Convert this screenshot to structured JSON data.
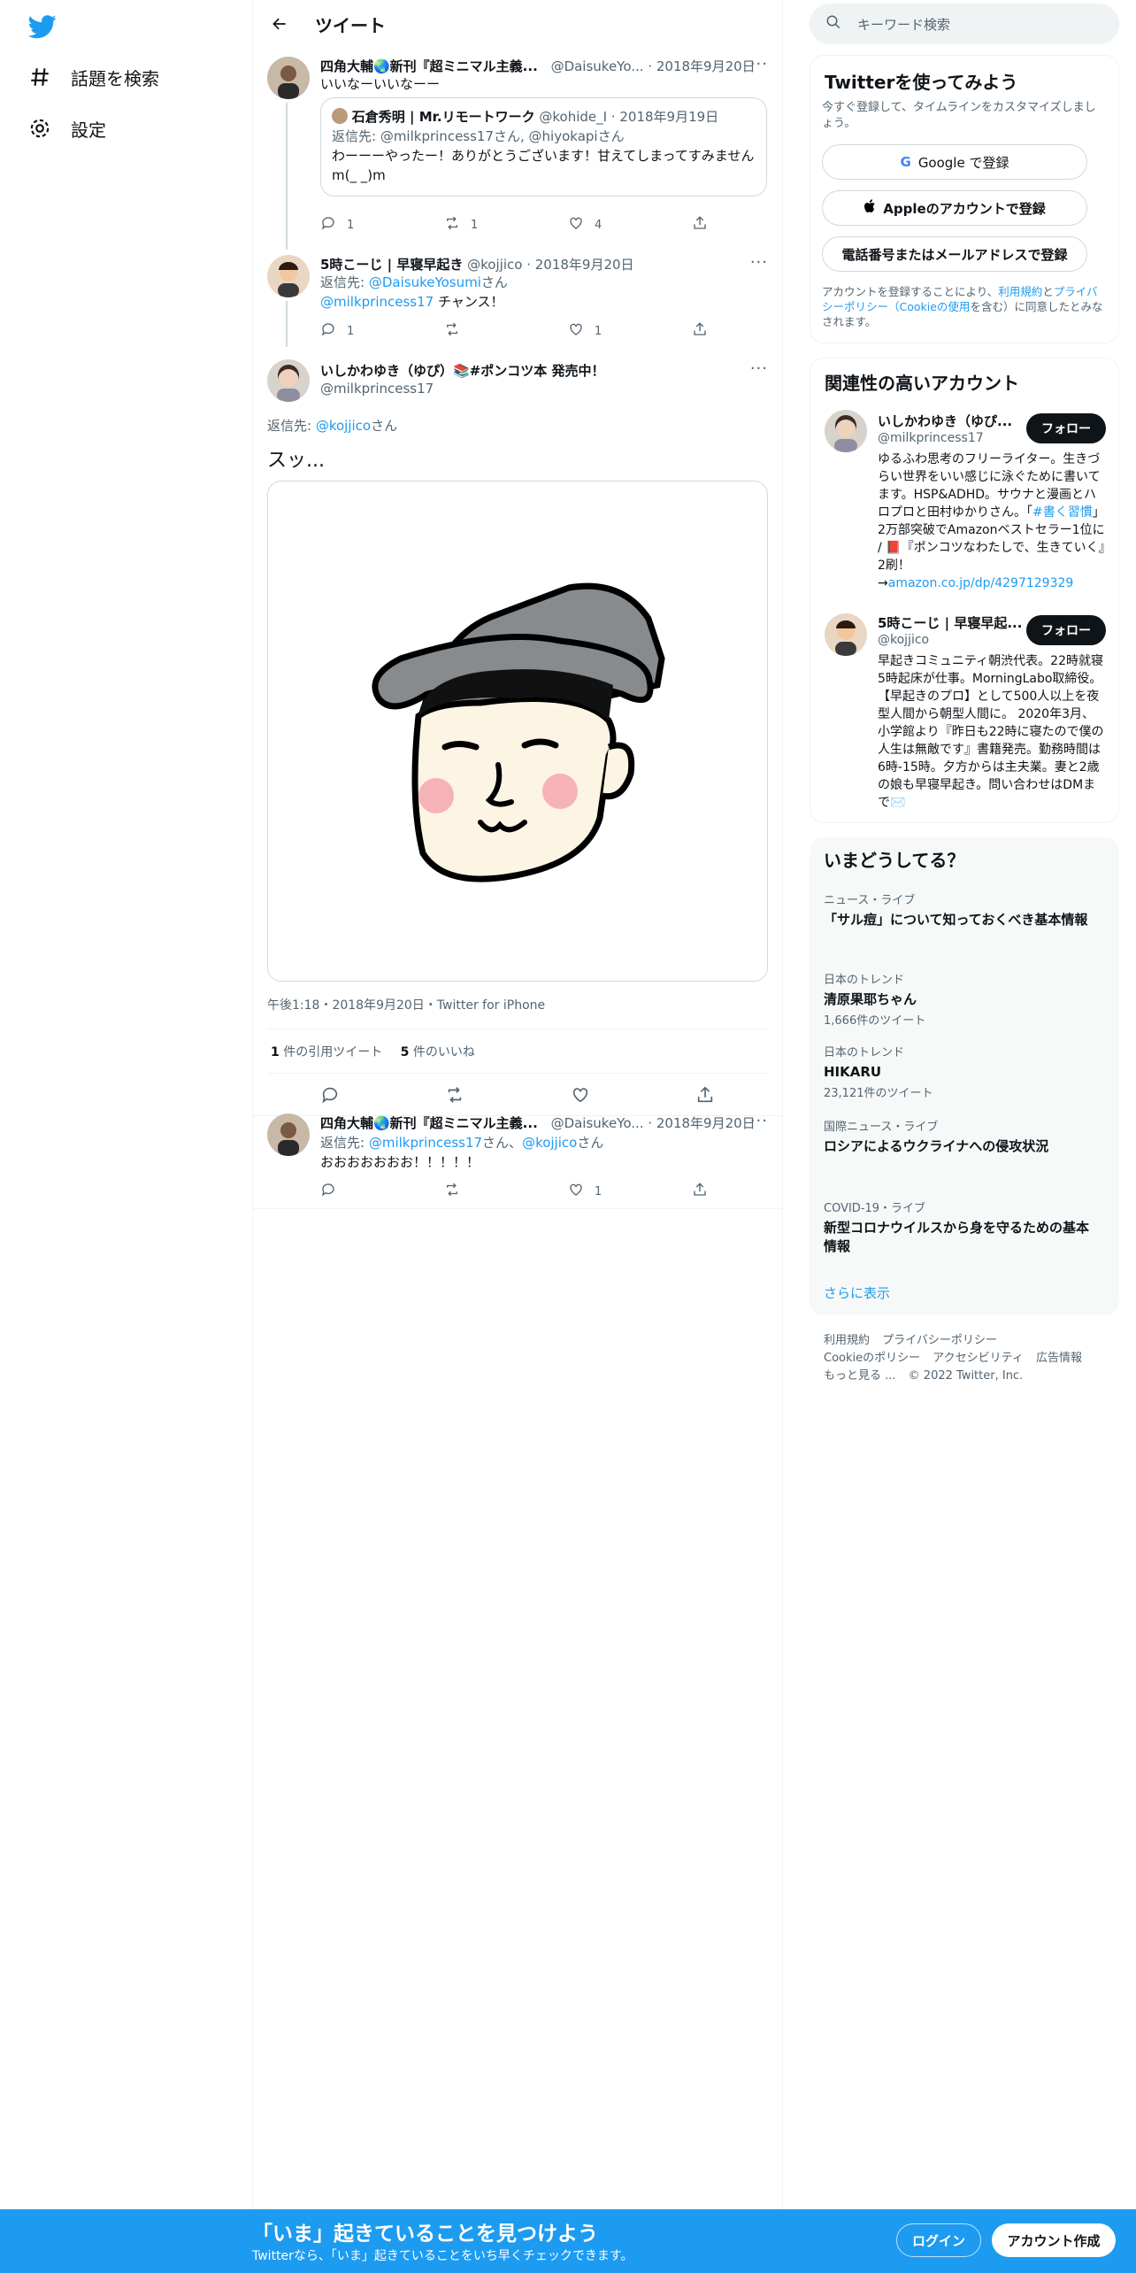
{
  "nav": {
    "logo_icon": "twitter-bird-icon",
    "items": [
      {
        "icon": "hashtag-icon",
        "label": "話題を検索"
      },
      {
        "icon": "gear-icon",
        "label": "設定"
      }
    ]
  },
  "header": {
    "title": "ツイート"
  },
  "tweets": [
    {
      "name": "四角大輔🌏新刊『超ミニマル主義...",
      "handle": "@DaisukeYo...",
      "date": "· 2018年9月20日",
      "text": "いいなーいいなーー",
      "quote": {
        "name": "石倉秀明 | Mr.リモートワーク",
        "handle": "@kohide_I",
        "date": "· 2018年9月19日",
        "reply_to": "返信先: @milkprincess17さん, @hiyokapiさん",
        "text": "わーーーやったー！ありがとうございます！甘えてしまってすみませんm(_ _)m"
      },
      "reply_count": "1",
      "retweet_count": "1",
      "like_count": "4"
    },
    {
      "name": "5時こーじ | 早寝早起き",
      "handle": "@kojjico",
      "date": "· 2018年9月20日",
      "reply_label": "返信先:",
      "reply_mention": "@DaisukeYosumi",
      "reply_suffix": "さん",
      "text_mention": "@milkprincess17",
      "text": " チャンス！",
      "reply_count": "1",
      "retweet_count": "",
      "like_count": "1"
    }
  ],
  "focus": {
    "name": "いしかわゆき（ゆぴ）📚#ポンコツ本 発売中！",
    "handle": "@milkprincess17",
    "reply_label": "返信先:",
    "reply_mention": "@kojjico",
    "reply_suffix": "さん",
    "text": "スッ...",
    "meta": "午後1:18・2018年9月20日・Twitter for iPhone",
    "quote_count": "1",
    "quote_label": "件の引用ツイート",
    "like_count": "5",
    "like_label": "件のいいね"
  },
  "reply": {
    "name": "四角大輔🌏新刊『超ミニマル主義...",
    "handle": "@DaisukeYo...",
    "date": "· 2018年9月20日",
    "reply_label": "返信先:",
    "mention1": "@milkprincess17",
    "sep": "さん、",
    "mention2": "@kojjico",
    "suffix": "さん",
    "text": "おおおおおおお！！！！！",
    "reply_count": "",
    "retweet_count": "",
    "like_count": "1"
  },
  "right": {
    "search_placeholder": "キーワード検索",
    "signup": {
      "title": "Twitterを使ってみよう",
      "subtitle": "今すぐ登録して、タイムラインをカスタマイズしましょう。",
      "google": "Google で登録",
      "apple": "Appleのアカウントで登録",
      "phone": "電話番号またはメールアドレスで登録",
      "terms_pre": "アカウントを登録することにより、",
      "terms_link1": "利用規約",
      "terms_mid1": "と",
      "terms_link2": "プライバシーポリシー（Cookieの使用",
      "terms_post": "を含む）に同意したとみなされます。"
    },
    "relevant": {
      "title": "関連性の高いアカウント",
      "accounts": [
        {
          "name": "いしかわゆき（ゆぴ...",
          "handle": "@milkprincess17",
          "follow": "フォロー",
          "bio_1": "ゆるふわ思考のフリーライター。生きづらい世界をいい感じに泳ぐために書いてます。HSP&ADHD。サウナと漫画とハロプロと田村ゆかりさん。「",
          "bio_link": "#書く習慣",
          "bio_2": "」2万部突破でAmazonベストセラー1位に / 📕『ポンコツなわたしで、生きていく』2刷！→",
          "bio_url": "amazon.co.jp/dp/4297129329"
        },
        {
          "name": "5時こーじ | 早寝早起...",
          "handle": "@kojjico",
          "follow": "フォロー",
          "bio_1": "早起きコミュニティ朝渋代表。22時就寝5時起床が仕事。MorningLabo取締役。【早起きのプロ】として500人以上を夜型人間から朝型人間に。 2020年3月、小学館より『昨日も22時に寝たので僕の人生は無敵です』書籍発売。勤務時間は6時-15時。夕方からは主夫業。妻と2歳の娘も早寝早起き。問い合わせはDMまで✉️"
        }
      ]
    },
    "trends": {
      "title": "いまどうしてる？",
      "items": [
        {
          "category": "ニュース・ライブ",
          "name": "「サル痘」について知っておくべき基本情報",
          "count": ""
        },
        {
          "category": "日本のトレンド",
          "name": "清原果耶ちゃん",
          "count": "1,666件のツイート"
        },
        {
          "category": "日本のトレンド",
          "name": "HIKARU",
          "count": "23,121件のツイート"
        },
        {
          "category": "国際ニュース・ライブ",
          "name": "ロシアによるウクライナへの侵攻状況",
          "count": ""
        },
        {
          "category": "COVID-19・ライブ",
          "name": "新型コロナウイルスから身を守るための基本情報",
          "count": ""
        }
      ],
      "show_more": "さらに表示"
    },
    "footer": {
      "terms": "利用規約",
      "privacy": "プライバシーポリシー",
      "cookie": "Cookieのポリシー",
      "accessibility": "アクセシビリティ",
      "ads": "広告情報",
      "more": "もっと見る ...",
      "copyright": "© 2022 Twitter, Inc."
    }
  },
  "bottom_bar": {
    "title": "「いま」起きていることを見つけよう",
    "subtitle": "Twitterなら、「いま」起きていることをいち早くチェックできます。",
    "login": "ログイン",
    "signup": "アカウント作成"
  },
  "colors": {
    "accent": "#1d9bf0",
    "text": "#0f1419",
    "muted": "#536471",
    "border": "#eff3f4"
  }
}
